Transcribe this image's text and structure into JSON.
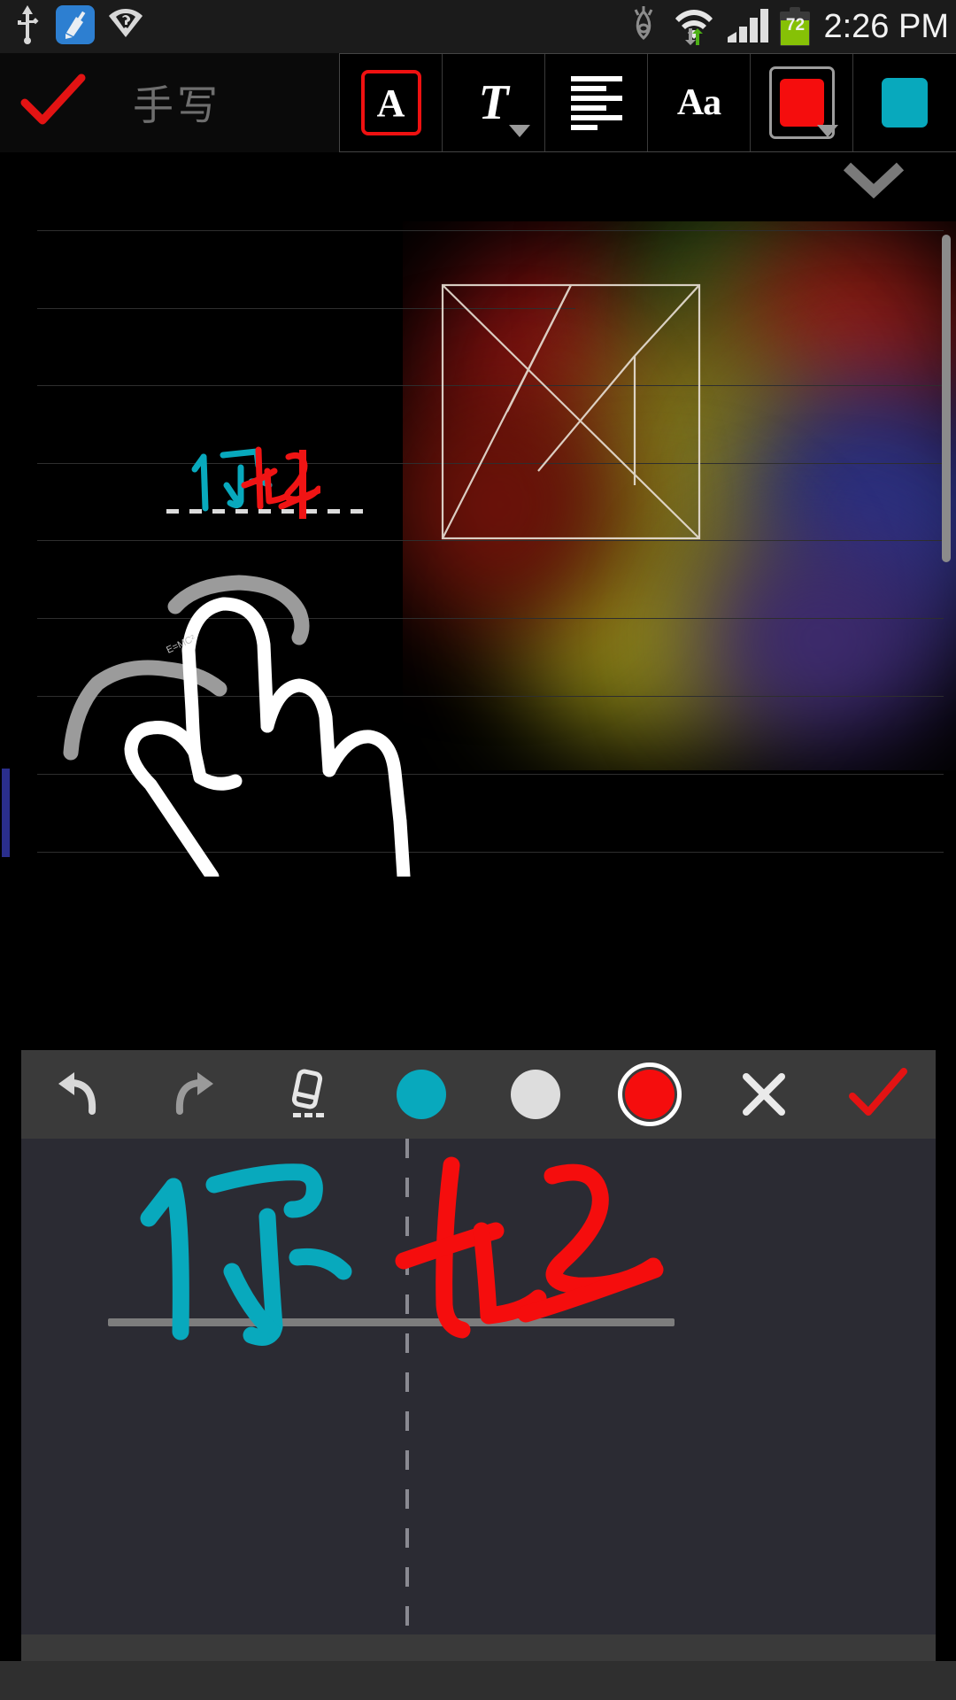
{
  "statusbar": {
    "clock": "2:26 PM",
    "battery_percent": "72",
    "left_icons": [
      {
        "name": "usb-icon",
        "glyph": "USB"
      },
      {
        "name": "spen-cleanup-icon",
        "glyph": "brush"
      },
      {
        "name": "wifi-unknown-icon",
        "glyph": "wifi-question"
      }
    ],
    "right_icons": [
      {
        "name": "smart-stay-eye-icon",
        "glyph": "eye"
      },
      {
        "name": "wifi-transfer-icon",
        "glyph": "wifi-arrows"
      },
      {
        "name": "signal-bars-icon",
        "glyph": "bars"
      },
      {
        "name": "battery-icon",
        "glyph": "battery"
      }
    ]
  },
  "toolbar": {
    "confirm_label": "done-check",
    "title": "手写",
    "buttons": [
      {
        "name": "text-style-button",
        "label": "A",
        "selected": true
      },
      {
        "name": "font-family-button",
        "label": "T",
        "has_dropdown": true
      },
      {
        "name": "text-align-button",
        "label": "align"
      },
      {
        "name": "text-size-button",
        "label": "Aa"
      },
      {
        "name": "text-color-button",
        "label": "color",
        "color": "#f50d0d",
        "has_dropdown": true
      },
      {
        "name": "highlight-color-button",
        "label": "color2",
        "color": "#08a9bd"
      }
    ],
    "collapse_label": "chevron-down"
  },
  "canvas": {
    "note_text_cyan": "你",
    "note_text_red": "好",
    "tiny_annotation": "E=MC²",
    "ruled_line_count": 9,
    "selection_shape": "tangram-square-wireframe",
    "image_caption_hidden": ""
  },
  "handwriting_panel": {
    "tools": [
      {
        "name": "undo-button",
        "label": "↶"
      },
      {
        "name": "redo-button",
        "label": "↷"
      },
      {
        "name": "eraser-button",
        "label": "eraser"
      },
      {
        "name": "pen-color-cyan",
        "label": "cyan",
        "color": "#08a9bd",
        "selected": false
      },
      {
        "name": "pen-color-white",
        "label": "white",
        "color": "#dddddd",
        "selected": false
      },
      {
        "name": "pen-color-red",
        "label": "red",
        "color": "#f50d0d",
        "selected": true
      },
      {
        "name": "cancel-button",
        "label": "✕"
      },
      {
        "name": "accept-button",
        "label": "✓"
      }
    ],
    "stroke_preview_cyan": "你",
    "stroke_preview_red": "好"
  },
  "colors": {
    "accent_red": "#f50d0d",
    "accent_cyan": "#08a9bd",
    "status_bg": "#1b1b1b",
    "panel_bg": "#2b2b33",
    "panel_toolbar_bg": "#3a3a3a",
    "battery_green": "#86c106"
  }
}
